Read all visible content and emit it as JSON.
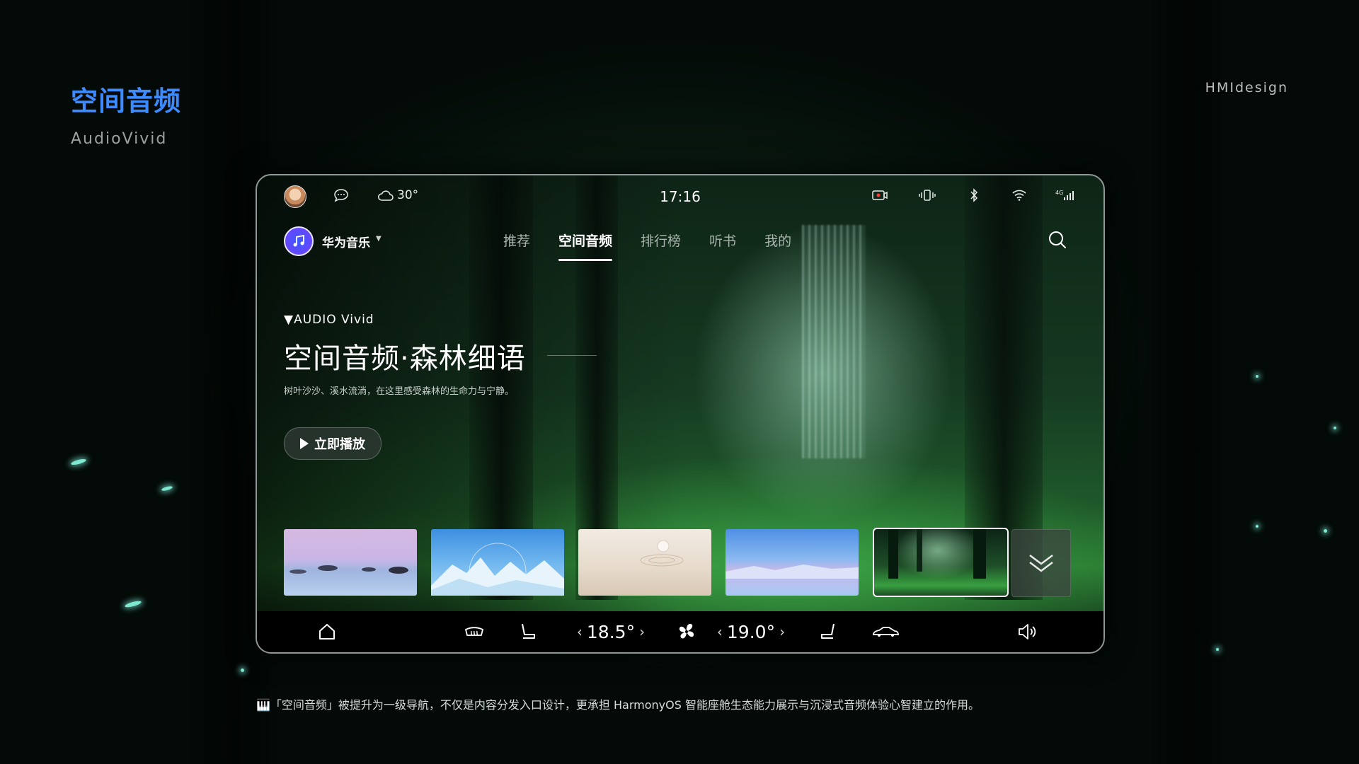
{
  "page": {
    "title": "空间音频",
    "subtitle": "AudioVivid",
    "brand": "HMIdesign",
    "caption": "「空间音频」被提升为一级导航，不仅是内容分发入口设计，更承担 HarmonyOS 智能座舱生态能力展示与沉浸式音频体验心智建立的作用。"
  },
  "statusbar": {
    "time": "17:16",
    "weather": "30°",
    "icons": [
      "avatar",
      "message-icon",
      "cloud-icon",
      "camera-record-icon",
      "vibrate-icon",
      "bluetooth-icon",
      "wifi-icon",
      "cellular-signal-icon"
    ]
  },
  "app": {
    "name": "华为音乐",
    "tabs": [
      {
        "label": "推荐",
        "active": false
      },
      {
        "label": "空间音频",
        "active": true
      },
      {
        "label": "排行榜",
        "active": false
      },
      {
        "label": "听书",
        "active": false
      },
      {
        "label": "我的",
        "active": false
      }
    ]
  },
  "hero": {
    "badge": "AUDIO Vivid",
    "title": "空间音频·森林细语",
    "description": "树叶沙沙、溪水流淌，在这里感受森林的生命力与宁静。",
    "play_label": "立即播放"
  },
  "thumbnails": [
    {
      "name": "lake-rocks",
      "selected": false
    },
    {
      "name": "ice-glacier",
      "selected": false
    },
    {
      "name": "desert-sand",
      "selected": false
    },
    {
      "name": "sky-sea",
      "selected": false
    },
    {
      "name": "forest",
      "selected": true
    }
  ],
  "dock": {
    "left_temp": "18.5°",
    "right_temp": "19.0°",
    "icons": [
      "home-icon",
      "defrost-icon",
      "seat-left-icon",
      "fan-icon",
      "seat-right-icon",
      "car-icon",
      "volume-icon"
    ]
  },
  "colors": {
    "title_accent": "#3d8bff",
    "forest_green": "#2a7a32"
  }
}
